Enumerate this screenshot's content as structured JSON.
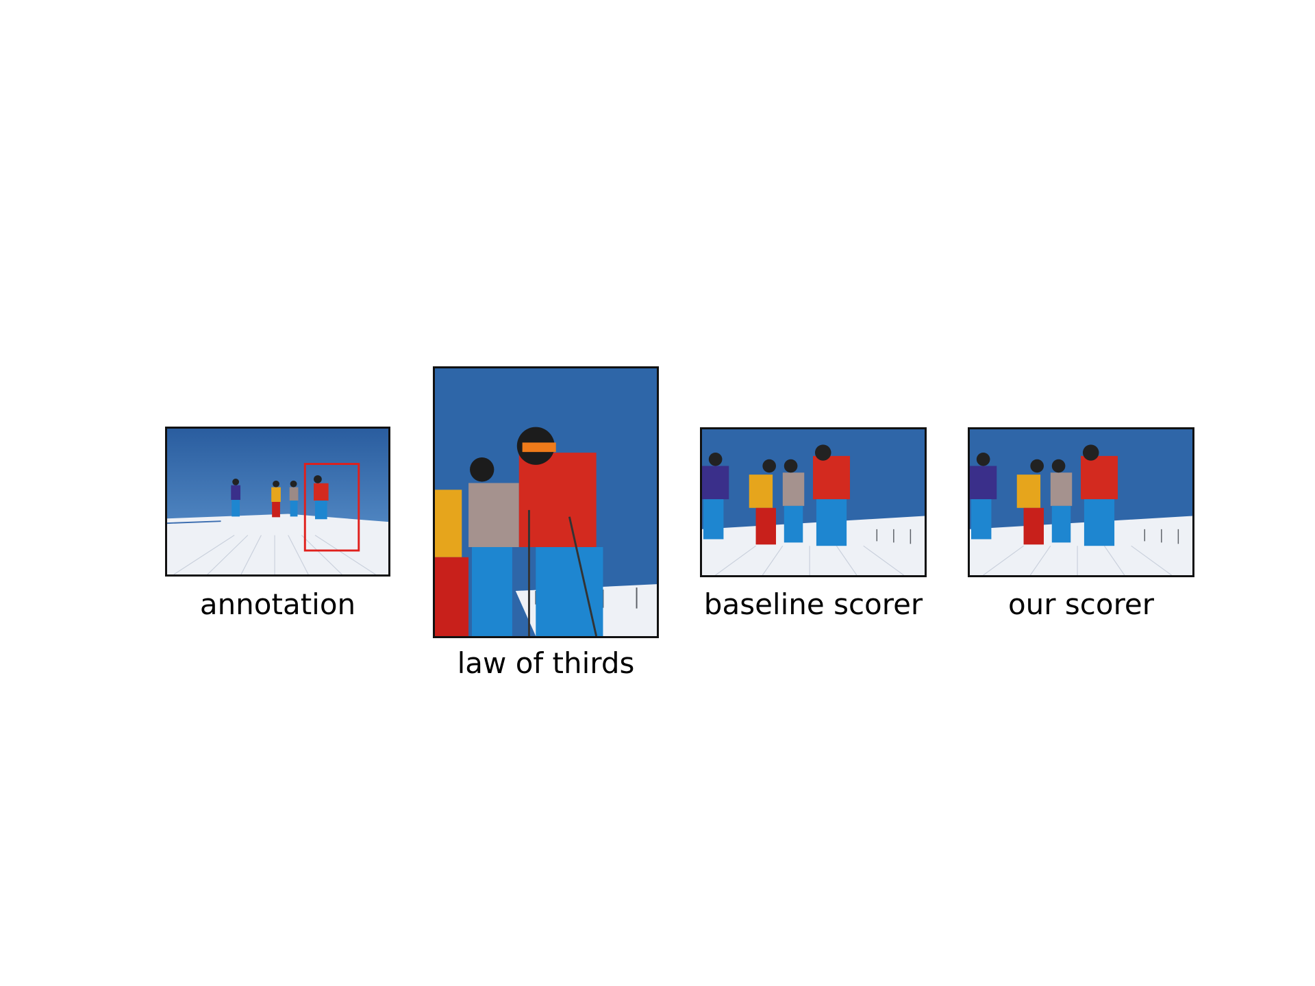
{
  "figure": {
    "panels": [
      {
        "caption": "annotation"
      },
      {
        "caption": "law of thirds"
      },
      {
        "caption": "baseline scorer"
      },
      {
        "caption": "our scorer"
      }
    ]
  },
  "colors": {
    "sky": "#2f66a8",
    "snow": "#eef1f6",
    "frame": "#111111",
    "annotation_box": "#e0201c",
    "jacket_red": "#d32a1f",
    "jacket_yellow": "#e6a51c",
    "jacket_purple": "#3a2f8a",
    "pants_blue": "#1e86d0"
  }
}
